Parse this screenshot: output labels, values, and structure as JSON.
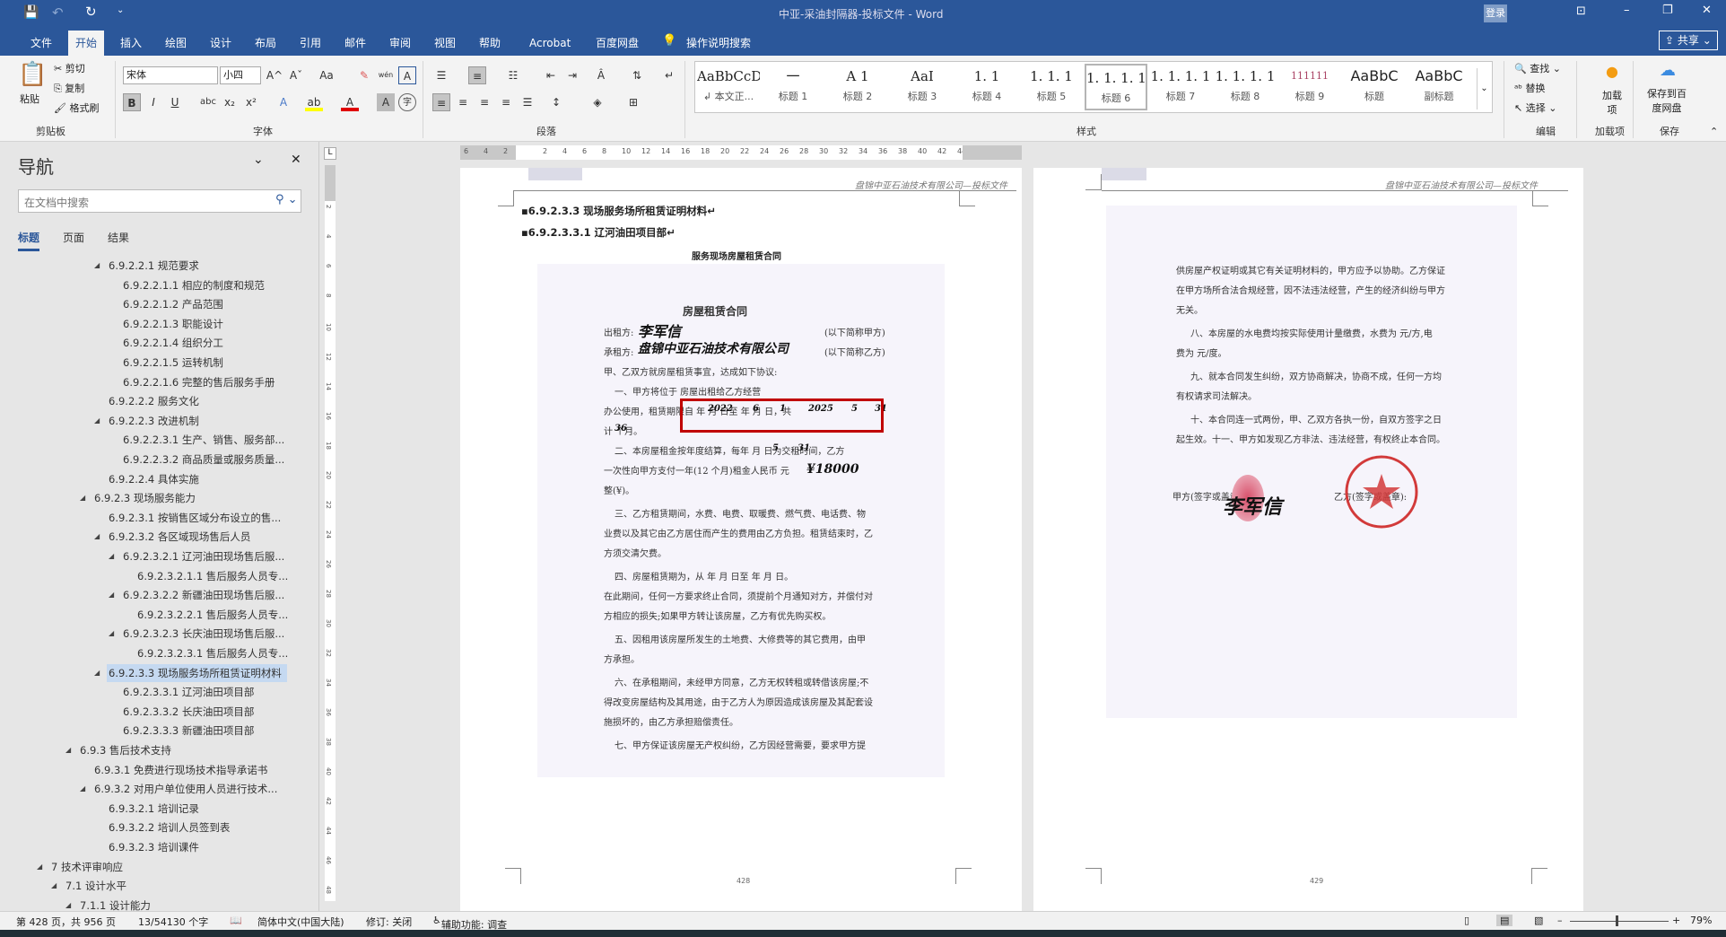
{
  "window": {
    "title": "中亚-采油封隔器-投标文件 - Word",
    "login": "登录",
    "share": "共享"
  },
  "tabs": [
    "文件",
    "开始",
    "插入",
    "绘图",
    "设计",
    "布局",
    "引用",
    "邮件",
    "审阅",
    "视图",
    "帮助",
    "Acrobat",
    "百度网盘"
  ],
  "active_tab": "开始",
  "tell_me": "操作说明搜索",
  "ribbon": {
    "clipboard": {
      "paste": "粘贴",
      "cut": "剪切",
      "copy": "复制",
      "format_painter": "格式刷",
      "label": "剪贴板"
    },
    "font": {
      "name": "宋体",
      "size": "小四",
      "label": "字体",
      "bold": "B",
      "italic": "I",
      "underline": "U",
      "strike": "abc",
      "sub": "x₂",
      "sup": "x²",
      "grow": "A^",
      "shrink": "Aˇ",
      "case": "Aa",
      "clear": "✎",
      "phonetic": "wén",
      "border": "A",
      "effects": "A",
      "highlight": "ab",
      "color": "A",
      "shade": "A",
      "enclose": "字",
      "highlight_color": "#ffff00",
      "font_color": "#e00000"
    },
    "paragraph": {
      "label": "段落"
    },
    "styles": {
      "label": "样式",
      "items": [
        {
          "preview": "AaBbCcDdI",
          "label": "↲ 本文正..."
        },
        {
          "preview": "一",
          "label": "标题 1"
        },
        {
          "preview": "A 1",
          "label": "标题 2"
        },
        {
          "preview": "AaI",
          "label": "标题 3"
        },
        {
          "preview": "1. 1",
          "label": "标题 4"
        },
        {
          "preview": "1. 1. 1",
          "label": "标题 5"
        },
        {
          "preview": "1. 1. 1. 1",
          "label": "标题 6"
        },
        {
          "preview": "1. 1. 1. 1",
          "label": "标题 7"
        },
        {
          "preview": "1. 1. 1. 1",
          "label": "标题 8"
        },
        {
          "preview": "111111",
          "label": "标题 9"
        },
        {
          "preview": "AaBbC",
          "label": "标题"
        },
        {
          "preview": "AaBbC",
          "label": "副标题"
        }
      ],
      "selected": "标题 6"
    },
    "editing": {
      "find": "查找",
      "replace": "替换",
      "select": "选择",
      "label": "编辑"
    },
    "addins": {
      "button": "加载项",
      "label": "加载项"
    },
    "save": {
      "button": "保存到百度网盘",
      "label": "保存"
    }
  },
  "nav": {
    "title": "导航",
    "search_placeholder": "在文档中搜索",
    "tabs": [
      "标题",
      "页面",
      "结果"
    ],
    "active_tab": "标题",
    "items": [
      {
        "t": "6.9.2.2.1 规范要求",
        "d": 4,
        "c": true
      },
      {
        "t": "6.9.2.2.1.1 相应的制度和规范",
        "d": 5
      },
      {
        "t": "6.9.2.2.1.2 产品范围",
        "d": 5
      },
      {
        "t": "6.9.2.2.1.3 职能设计",
        "d": 5
      },
      {
        "t": "6.9.2.2.1.4 组织分工",
        "d": 5
      },
      {
        "t": "6.9.2.2.1.5 运转机制",
        "d": 5
      },
      {
        "t": "6.9.2.2.1.6 完整的售后服务手册",
        "d": 5
      },
      {
        "t": "6.9.2.2.2 服务文化",
        "d": 4
      },
      {
        "t": "6.9.2.2.3 改进机制",
        "d": 4,
        "c": true
      },
      {
        "t": "6.9.2.2.3.1 生产、销售、服务部...",
        "d": 5
      },
      {
        "t": "6.9.2.2.3.2 商品质量或服务质量...",
        "d": 5
      },
      {
        "t": "6.9.2.2.4 具体实施",
        "d": 4
      },
      {
        "t": "6.9.2.3 现场服务能力",
        "d": 3,
        "c": true
      },
      {
        "t": "6.9.2.3.1 按销售区域分布设立的售...",
        "d": 4
      },
      {
        "t": "6.9.2.3.2 各区域现场售后人员",
        "d": 4,
        "c": true
      },
      {
        "t": "6.9.2.3.2.1 辽河油田现场售后服...",
        "d": 5,
        "c": true
      },
      {
        "t": "6.9.2.3.2.1.1 售后服务人员专...",
        "d": 6
      },
      {
        "t": "6.9.2.3.2.2 新疆油田现场售后服...",
        "d": 5,
        "c": true
      },
      {
        "t": "6.9.2.3.2.2.1 售后服务人员专...",
        "d": 6
      },
      {
        "t": "6.9.2.3.2.3 长庆油田现场售后服...",
        "d": 5,
        "c": true
      },
      {
        "t": "6.9.2.3.2.3.1 售后服务人员专...",
        "d": 6
      },
      {
        "t": "6.9.2.3.3 现场服务场所租赁证明材料",
        "d": 4,
        "c": true,
        "sel": true
      },
      {
        "t": "6.9.2.3.3.1 辽河油田项目部",
        "d": 5
      },
      {
        "t": "6.9.2.3.3.2 长庆油田项目部",
        "d": 5
      },
      {
        "t": "6.9.2.3.3.3 新疆油田项目部",
        "d": 5
      },
      {
        "t": "6.9.3 售后技术支持",
        "d": 2,
        "c": true
      },
      {
        "t": "6.9.3.1 免费进行现场技术指导承诺书",
        "d": 3
      },
      {
        "t": "6.9.3.2 对用户单位使用人员进行技术...",
        "d": 3,
        "c": true
      },
      {
        "t": "6.9.3.2.1 培训记录",
        "d": 4
      },
      {
        "t": "6.9.3.2.2 培训人员签到表",
        "d": 4
      },
      {
        "t": "6.9.3.2.3 培训课件",
        "d": 4
      },
      {
        "t": "7 技术评审响应",
        "d": 0,
        "c": true
      },
      {
        "t": "7.1 设计水平",
        "d": 1,
        "c": true
      },
      {
        "t": "7.1.1 设计能力",
        "d": 2,
        "c": true
      }
    ]
  },
  "ruler": {
    "h_ticks": [
      "6",
      "4",
      "2",
      "",
      "2",
      "4",
      "6",
      "8",
      "10",
      "12",
      "14",
      "16",
      "18",
      "20",
      "22",
      "24",
      "26",
      "28",
      "30",
      "32",
      "34",
      "36",
      "38",
      "40",
      "42",
      "44",
      "46",
      "48"
    ],
    "v_ticks": [
      "2",
      "4",
      "6",
      "8",
      "10",
      "12",
      "14",
      "16",
      "18",
      "20",
      "22",
      "24",
      "26",
      "28",
      "30",
      "32",
      "34",
      "36",
      "38",
      "40",
      "42",
      "44",
      "46",
      "48"
    ]
  },
  "doc": {
    "header_text": "盘锦中亚石油技术有限公司—投标文件",
    "heading1": "6.9.2.3.3 现场服务场所租赁证明材料",
    "heading2": "6.9.2.3.3.1 辽河油田项目部",
    "caption": "服务现场房屋租赁合同",
    "page_left": "428",
    "page_right": "429",
    "highlight_color": "#c00000",
    "scan_left": {
      "title": "房屋租赁合同",
      "lessor": "出租方:",
      "lessor_note": "(以下简称甲方)",
      "lessee": "承租方:",
      "lessee_note": "(以下简称乙方)",
      "lines": [
        "甲、乙双方就房屋租赁事宜，达成如下协议:",
        "一、甲方将位于                                  房屋出租给乙方经营",
        "办公使用，租赁期限自       年    月    日至       年    月    日，共",
        "计      个月。",
        "二、本房屋租金按年度结算，每年    月    日为交租时间，乙方",
        "一次性向甲方支付一年(12 个月)租金人民币                        元",
        "整(¥)。",
        "三、乙方租赁期间，水费、电费、取暖费、燃气费、电话费、物",
        "业费以及其它由乙方居住而产生的费用由乙方负担。租赁结束时，乙",
        "方须交清欠费。",
        "四、房屋租赁期为，从       年    月    日至       年    月    日。",
        "在此期间，任何一方要求终止合同，须提前个月通知对方，并偿付对",
        "方相应的损失;如果甲方转让该房屋，乙方有优先购买权。",
        "五、因租用该房屋所发生的土地费、大修费等的其它费用，由甲",
        "方承担。",
        "六、在承租期间，未经甲方同意，乙方无权转租或转借该房屋;不",
        "得改变房屋结构及其用途，由于乙方人为原因造成该房屋及其配套设",
        "施损坏的，由乙方承担赔偿责任。",
        "七、甲方保证该房屋无产权纠纷，乙方因经营需要，要求甲方提"
      ],
      "handwriting": {
        "start_year": "2022",
        "start_month": "6",
        "start_day": "1",
        "end_year": "2025",
        "end_month": "5",
        "end_day": "31",
        "months": "36",
        "pay_month": "5",
        "pay_day": "31",
        "amount": "¥18000"
      }
    },
    "scan_right": {
      "lines": [
        "供房屋产权证明或其它有关证明材料的，甲方应予以协助。乙方保证",
        "在甲方场所合法合规经营，因不法违法经营，产生的经济纠纷与甲方",
        "无关。",
        "八、本房屋的水电费均按实际使用计量缴费，水费为      元/方,电",
        "费为      元/度。",
        "九、就本合同发生纠纷，双方协商解决，协商不成，任何一方均",
        "有权请求司法解决。",
        "十、本合同连一式两份，甲、乙双方各执一份，自双方签字之日",
        "起生效。十一、甲方如发现乙方非法、违法经营，有权终止本合同。"
      ],
      "sign_a": "甲方(签字或盖章):",
      "sign_b": "乙方(签字或盖章):",
      "seal_color": "#d23a3a"
    }
  },
  "status": {
    "page": "第 428 页，共 956 页",
    "words": "13/54130 个字",
    "language": "简体中文(中国大陆)",
    "track": "修订: 关闭",
    "accessibility": "辅助功能: 调查",
    "zoom": "79%",
    "zoom_level": 79
  }
}
